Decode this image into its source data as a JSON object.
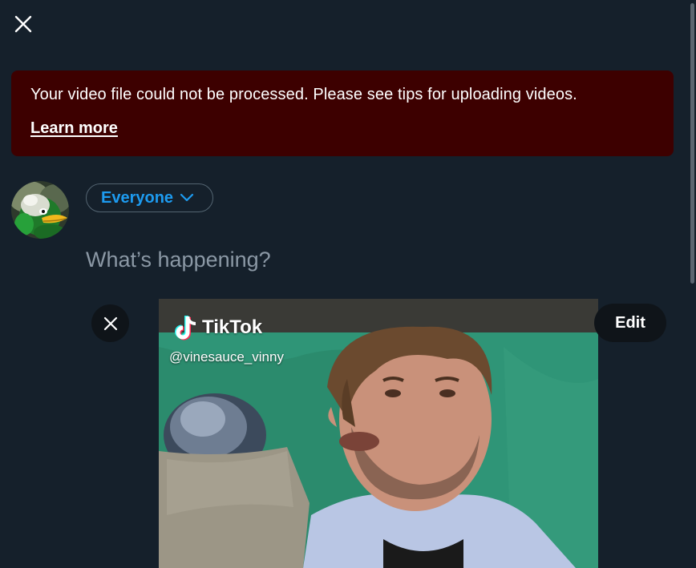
{
  "header": {
    "close_icon": "close-icon"
  },
  "error": {
    "message": "Your video file could not be processed. Please see tips for uploading videos.",
    "link_label": "Learn more",
    "background": "#3d0000"
  },
  "composer": {
    "audience_label": "Everyone",
    "audience_icon": "chevron-down-icon",
    "placeholder": "What’s happening?",
    "value": "",
    "avatar_icon": "duck-avatar"
  },
  "media": {
    "remove_icon": "close-icon",
    "edit_label": "Edit",
    "watermark_brand": "TikTok",
    "watermark_handle": "@vinesauce_vinny"
  },
  "colors": {
    "background": "#15202b",
    "accent": "#1d9bf0",
    "error_bg": "#3d0000",
    "placeholder": "#8b98a5"
  }
}
